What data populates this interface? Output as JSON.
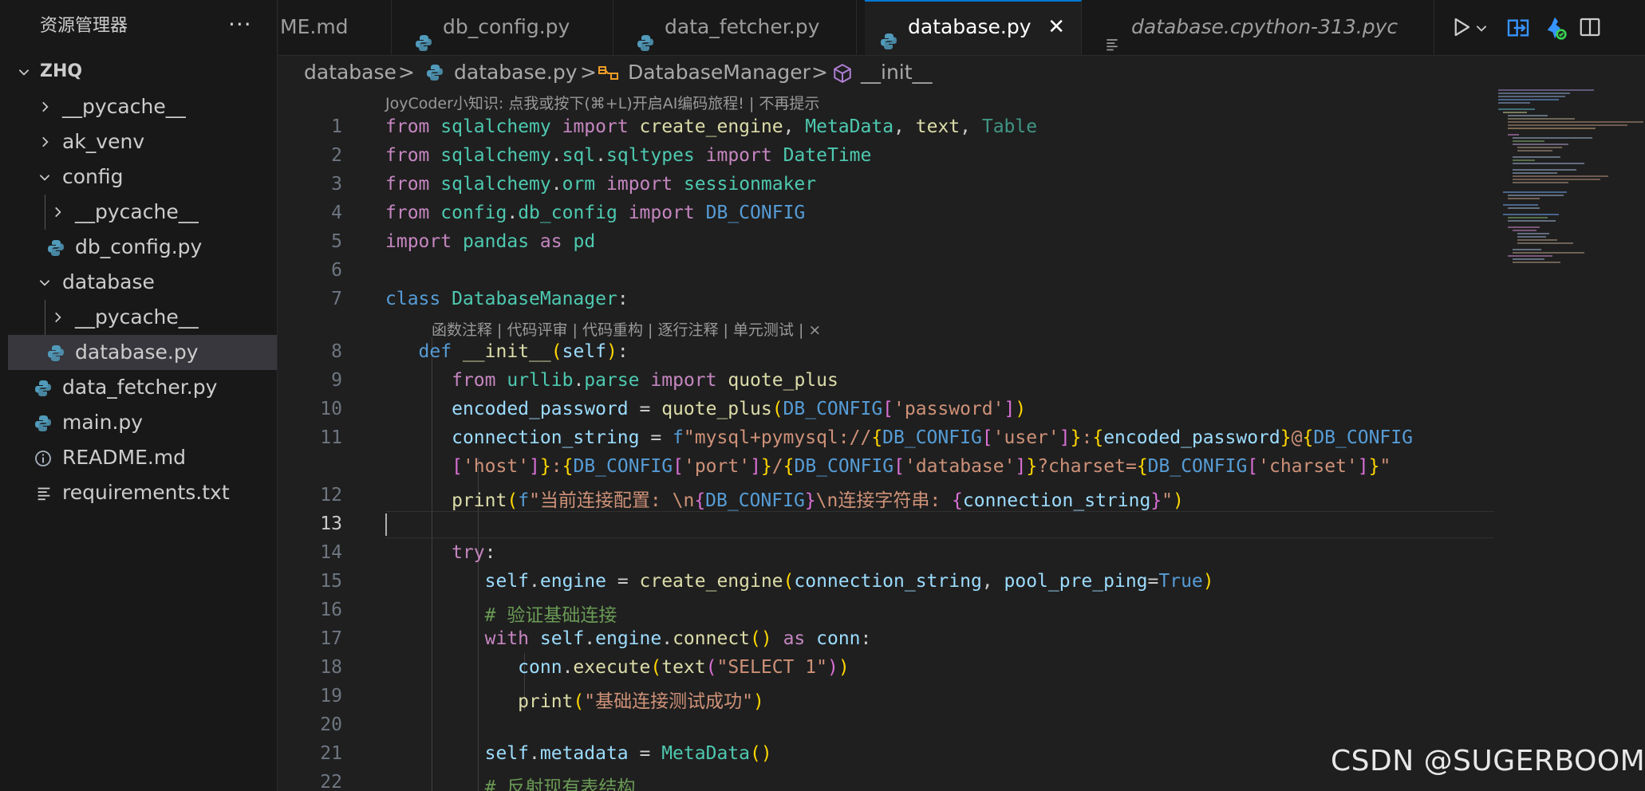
{
  "sidebar": {
    "title": "资源管理器",
    "more_label": "···",
    "root": "ZHQ",
    "items": [
      {
        "label": "__pycache__"
      },
      {
        "label": "ak_venv"
      },
      {
        "label": "config"
      },
      {
        "label": "__pycache__"
      },
      {
        "label": "db_config.py"
      },
      {
        "label": "database"
      },
      {
        "label": "__pycache__"
      },
      {
        "label": "database.py"
      },
      {
        "label": "data_fetcher.py"
      },
      {
        "label": "main.py"
      },
      {
        "label": "README.md"
      },
      {
        "label": "requirements.txt"
      }
    ]
  },
  "tabs": [
    {
      "label": "ME.md"
    },
    {
      "label": "db_config.py"
    },
    {
      "label": "data_fetcher.py"
    },
    {
      "label": "database.py",
      "active": true,
      "close": "✕"
    },
    {
      "label": "database.cpython-313.pyc",
      "italic": true
    }
  ],
  "breadcrumb": {
    "folder": "database",
    "file": "database.py",
    "class": "DatabaseManager",
    "method": "__init__",
    "sep": ">"
  },
  "hints": {
    "ai_hint": "JoyCoder小知识: 点我或按下(⌘+L)开启AI编码旅程! | 不再提示",
    "codelens": "函数注释 | 代码评审 | 代码重构 | 逐行注释 | 单元测试 | ×"
  },
  "editor": {
    "line_numbers": [
      "1",
      "2",
      "3",
      "4",
      "5",
      "6",
      "7",
      "8",
      "9",
      "10",
      "11",
      "",
      "12",
      "13",
      "14",
      "15",
      "16",
      "17",
      "18",
      "19",
      "20",
      "21",
      "22"
    ],
    "current_line": "13",
    "code": {
      "l1_from": "from",
      "l1_mod": "sqlalchemy",
      "l1_import": "import",
      "l1_a": "create_engine",
      "l1_b": "MetaData",
      "l1_c": "text",
      "l1_d": "Table",
      "l2_from": "from",
      "l2_mod1": "sqlalchemy",
      "l2_mod2": "sql",
      "l2_mod3": "sqltypes",
      "l2_import": "import",
      "l2_a": "DateTime",
      "l3_from": "from",
      "l3_mod1": "sqlalchemy",
      "l3_mod2": "orm",
      "l3_import": "import",
      "l3_a": "sessionmaker",
      "l4_from": "from",
      "l4_mod1": "config",
      "l4_mod2": "db_config",
      "l4_import": "import",
      "l4_a": "DB_CONFIG",
      "l5_import": "import",
      "l5_mod": "pandas",
      "l5_as": "as",
      "l5_alias": "pd",
      "l7_class": "class",
      "l7_name": "DatabaseManager",
      "l8_def": "def",
      "l8_name": "__init__",
      "l8_self": "self",
      "l9_from": "from",
      "l9_mod1": "urllib",
      "l9_mod2": "parse",
      "l9_import": "import",
      "l9_a": "quote_plus",
      "l10_var": "encoded_password",
      "l10_fn": "quote_plus",
      "l10_cfg": "DB_CONFIG",
      "l10_key": "'password'",
      "l11_var": "connection_string",
      "l11_f": "f",
      "l11_s1": "\"mysql+pymysql://",
      "l11_cfg1": "DB_CONFIG",
      "l11_k1": "'user'",
      "l11_colon": ":",
      "l11_ep": "encoded_password",
      "l11_at": "@",
      "l11_cfg2": "DB_CONFIG",
      "l11b_k2": "'host'",
      "l11b_c1": ":",
      "l11b_cfg3": "DB_CONFIG",
      "l11b_k3": "'port'",
      "l11b_sl": "/",
      "l11b_cfg4": "DB_CONFIG",
      "l11b_k4": "'database'",
      "l11b_q": "?charset=",
      "l11b_cfg5": "DB_CONFIG",
      "l11b_k5": "'charset'",
      "l11b_end": "\"",
      "l12_fn": "print",
      "l12_f": "f",
      "l12_s1": "\"当前连接配置: \\n",
      "l12_cfg": "DB_CONFIG",
      "l12_s2": "\\n连接字符串: ",
      "l12_cs": "connection_string",
      "l12_end": "\"",
      "l14_try": "try",
      "l15_self": "self",
      "l15_attr": "engine",
      "l15_fn": "create_engine",
      "l15_cs": "connection_string",
      "l15_kw": "pool_pre_ping",
      "l15_true": "True",
      "l16_comment": "# 验证基础连接",
      "l17_with": "with",
      "l17_self": "self",
      "l17_attr": "engine",
      "l17_fn": "connect",
      "l17_as": "as",
      "l17_conn": "conn",
      "l18_conn": "conn",
      "l18_fn": "execute",
      "l18_fn2": "text",
      "l18_s": "\"SELECT 1\"",
      "l19_fn": "print",
      "l19_s": "\"基础连接测试成功\"",
      "l21_self": "self",
      "l21_attr": "metadata",
      "l21_cls": "MetaData",
      "l22_comment": "# 反射现有表结构"
    }
  },
  "watermark": "CSDN @SUGERBOOM",
  "colors": {
    "accent": "#0078d4",
    "python_icon": "#519aba",
    "keyword": "#c586c0",
    "string": "#ce9178",
    "function": "#dcdcaa",
    "variable": "#9cdcfe",
    "class": "#4ec9b0",
    "comment": "#6a9955"
  },
  "icons": [
    "ellipsis-icon",
    "chevron-down-icon",
    "chevron-right-icon",
    "python-file-icon",
    "info-icon",
    "text-file-icon",
    "close-icon",
    "run-icon",
    "split-editor-icon",
    "compare-icon",
    "copilot-icon",
    "symbol-class-icon",
    "symbol-method-icon"
  ]
}
